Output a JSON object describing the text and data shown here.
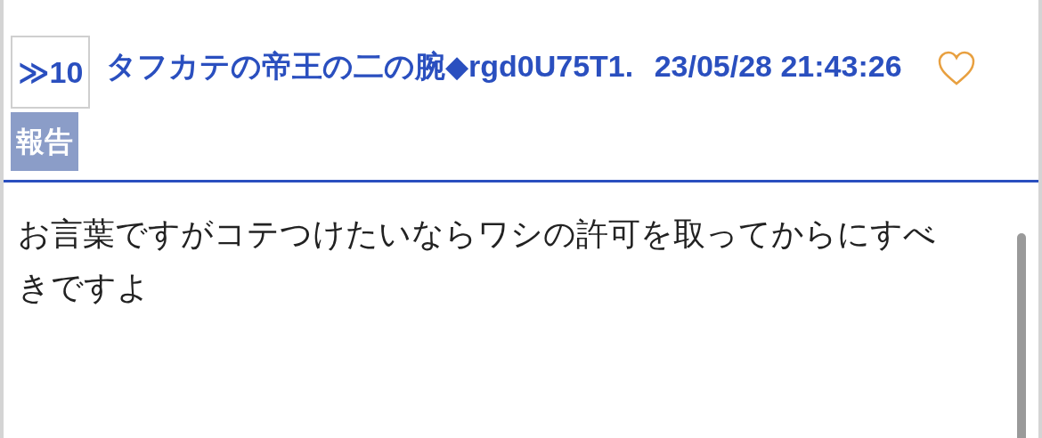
{
  "post": {
    "number": "≫10",
    "name": "タフカテの帝王の二の腕◆rgd0U75T1.",
    "datetime": "23/05/28 21:43:26",
    "liked": false,
    "report_label": "報告",
    "body": "お言葉ですがコテつけたいならワシの許可を取ってからにすべきですよ"
  }
}
